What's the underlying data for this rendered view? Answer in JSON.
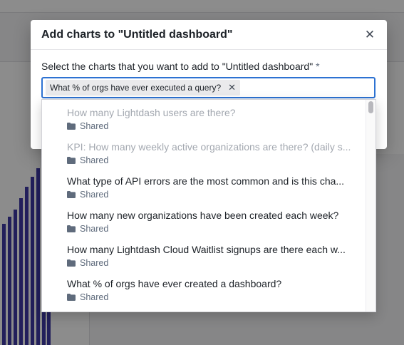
{
  "modal": {
    "title": "Add charts to \"Untitled dashboard\"",
    "close_icon": "close-icon",
    "field_label": "Select the charts that you want to add to \"Untitled dashboard\"",
    "required_mark": "*",
    "selected_tag": "What % of orgs have ever executed a query?",
    "tag_remove_icon": "close-icon"
  },
  "dropdown": {
    "items": [
      {
        "title": "How many Lightdash users are there?",
        "space": "Shared",
        "disabled": true
      },
      {
        "title": "KPI: How many weekly active organizations are there? (daily s...",
        "space": "Shared",
        "disabled": true
      },
      {
        "title": "What type of API errors are the most common and is this cha...",
        "space": "Shared",
        "disabled": false
      },
      {
        "title": "How many new organizations have been created each week?",
        "space": "Shared",
        "disabled": false
      },
      {
        "title": "How many Lightdash Cloud Waitlist signups are there each w...",
        "space": "Shared",
        "disabled": false
      },
      {
        "title": "What % of orgs have ever created a dashboard?",
        "space": "Shared",
        "disabled": false
      }
    ],
    "item_icon": "folder-icon"
  },
  "colors": {
    "accent": "#2d72d2",
    "background_chart_bars": "#3f3aa6"
  }
}
